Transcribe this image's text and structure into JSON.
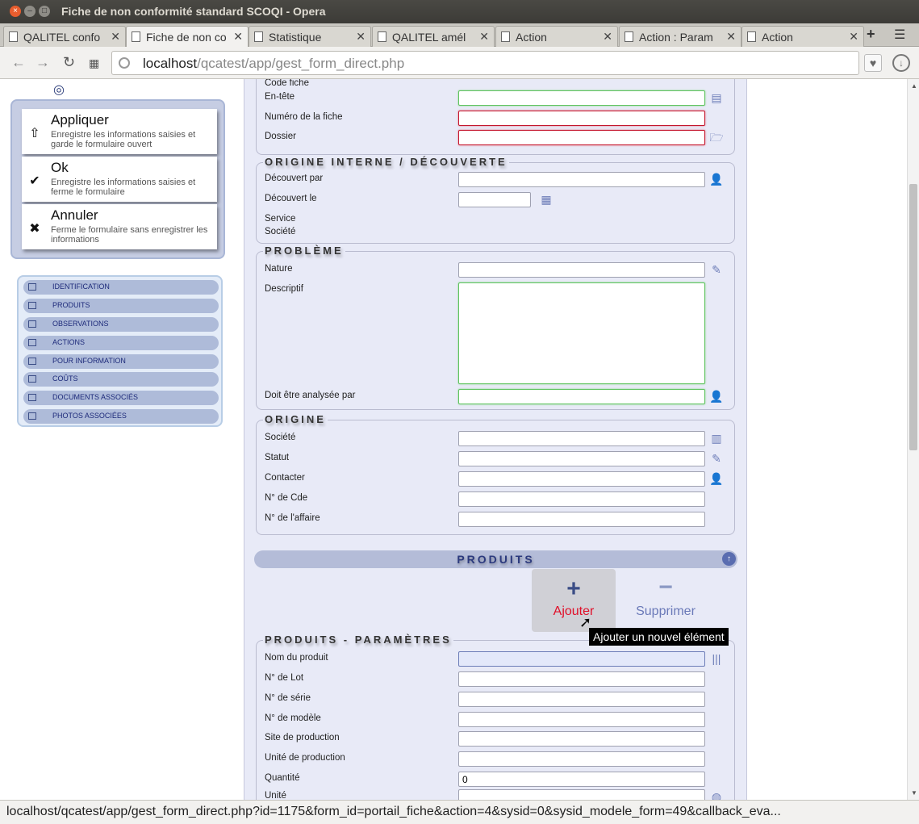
{
  "window": {
    "title": "Fiche de non conformité standard SCOQI - Opera"
  },
  "tabs": [
    {
      "label": "QALITEL confo",
      "active": false
    },
    {
      "label": "Fiche de non co",
      "active": true
    },
    {
      "label": "Statistique",
      "active": false
    },
    {
      "label": "QALITEL amél",
      "active": false
    },
    {
      "label": "Action",
      "active": false
    },
    {
      "label": "Action : Param",
      "active": false
    },
    {
      "label": "Action",
      "active": false
    }
  ],
  "address": {
    "host": "localhost",
    "path": "/qcatest/app/gest_form_direct.php"
  },
  "statusbar": {
    "text": "localhost/qcatest/app/gest_form_direct.php?id=1175&form_id=portail_fiche&action=4&sysid=0&sysid_modele_form=49&callback_eva..."
  },
  "actions": [
    {
      "label": "Appliquer",
      "desc": "Enregistre les informations saisies et garde le formulaire ouvert",
      "icon": "apply-icon"
    },
    {
      "label": "Ok",
      "desc": "Enregistre les informations saisies et ferme le formulaire",
      "icon": "check-icon"
    },
    {
      "label": "Annuler",
      "desc": "Ferme le formulaire sans enregistrer les informations",
      "icon": "cross-icon"
    }
  ],
  "nav": [
    {
      "label": "IDENTIFICATION"
    },
    {
      "label": "PRODUITS"
    },
    {
      "label": "OBSERVATIONS"
    },
    {
      "label": "ACTIONS"
    },
    {
      "label": "POUR INFORMATION"
    },
    {
      "label": "COÛTS"
    },
    {
      "label": "DOCUMENTS ASSOCIÉS"
    },
    {
      "label": "PHOTOS ASSOCIÉES"
    }
  ],
  "identification": {
    "code_fiche": "Code fiche",
    "entete": "En-tête",
    "numero": "Numéro de la fiche",
    "dossier": "Dossier"
  },
  "origine_interne": {
    "title": "ORIGINE INTERNE / DÉCOUVERTE",
    "decouvert_par": "Découvert par",
    "decouvert_le": "Découvert le",
    "service": "Service",
    "societe": "Société"
  },
  "probleme": {
    "title": "PROBLÈME",
    "nature": "Nature",
    "descriptif": "Descriptif",
    "analysee_par": "Doit être analysée par"
  },
  "origine": {
    "title": "ORIGINE",
    "societe": "Société",
    "statut": "Statut",
    "contacter": "Contacter",
    "cde": "N° de Cde",
    "affaire": "N° de l'affaire"
  },
  "produits": {
    "bar_title": "PRODUITS",
    "ajouter": "Ajouter",
    "supprimer": "Supprimer",
    "tooltip": "Ajouter un nouvel élément"
  },
  "produits_params": {
    "title": "PRODUITS - PARAMÈTRES",
    "nom": "Nom du produit",
    "lot": "N° de Lot",
    "serie": "N° de série",
    "modele": "N° de modèle",
    "site": "Site de production",
    "unite_prod": "Unité de production",
    "quantite": "Quantité",
    "quantite_value": "0",
    "unite": "Unité"
  }
}
